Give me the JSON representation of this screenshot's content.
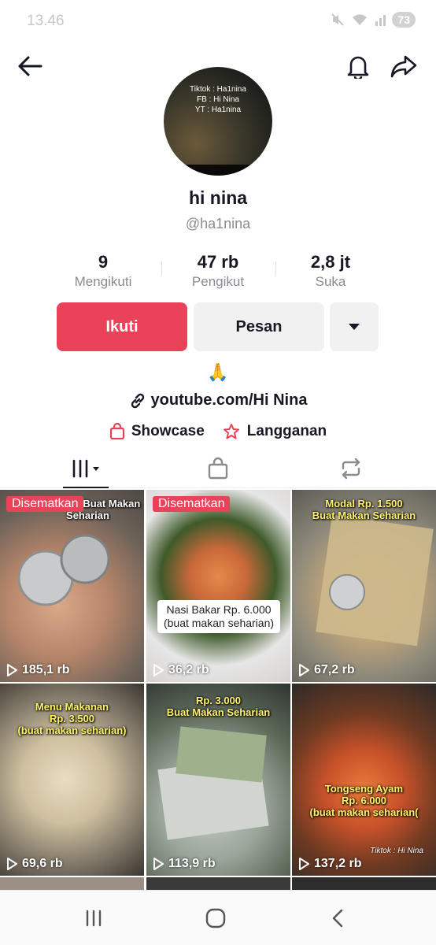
{
  "status_bar": {
    "time": "13.46",
    "battery": "73"
  },
  "profile": {
    "avatar_lines": [
      "Tiktok : Ha1nina",
      "FB : Hi Nina",
      "YT : Ha1nina"
    ],
    "display_name": "hi nina",
    "username": "@ha1nina"
  },
  "stats": [
    {
      "value": "9",
      "label": "Mengikuti"
    },
    {
      "value": "47 rb",
      "label": "Pengikut"
    },
    {
      "value": "2,8 jt",
      "label": "Suka"
    }
  ],
  "buttons": {
    "follow": "Ikuti",
    "message": "Pesan"
  },
  "bio": {
    "emoji": "🙏",
    "link": "youtube.com/Hi Nina",
    "showcase": "Showcase",
    "subscription": "Langganan"
  },
  "tabs": {
    "icons": [
      "grid-icon",
      "shopping-bag-icon",
      "repost-icon"
    ]
  },
  "videos": [
    {
      "pinned": "Disematkan",
      "caption": "Rp. 1.000 Buat Makan Seharian",
      "views": "185,1 rb"
    },
    {
      "pinned": "Disematkan",
      "caption": "Nasi Bakar Rp. 6.000 (buat makan seharian)",
      "views": "36,2 rb"
    },
    {
      "pinned": "",
      "caption_line1": "Modal Rp. 1.500",
      "caption_line2": "Buat Makan Seharian",
      "views": "67,2 rb"
    },
    {
      "caption_line1": "Menu Makanan",
      "caption_line2": "Rp. 3.500",
      "caption_line3": "(buat makan seharian)",
      "views": "69,6 rb"
    },
    {
      "caption_line1": "Rp. 3.000",
      "caption_line2": "Buat Makan Seharian",
      "views": "113,9 rb"
    },
    {
      "caption_line1": "Tongseng Ayam",
      "caption_line2": "Rp. 6.000",
      "caption_line3": "(buat makan seharian(",
      "watermark": "Tiktok : Hi Nina",
      "views": "137,2 rb"
    }
  ],
  "colors": {
    "accent": "#ea4359",
    "secondary_bg": "#f1f1f2",
    "muted_text": "#8a8b91"
  }
}
